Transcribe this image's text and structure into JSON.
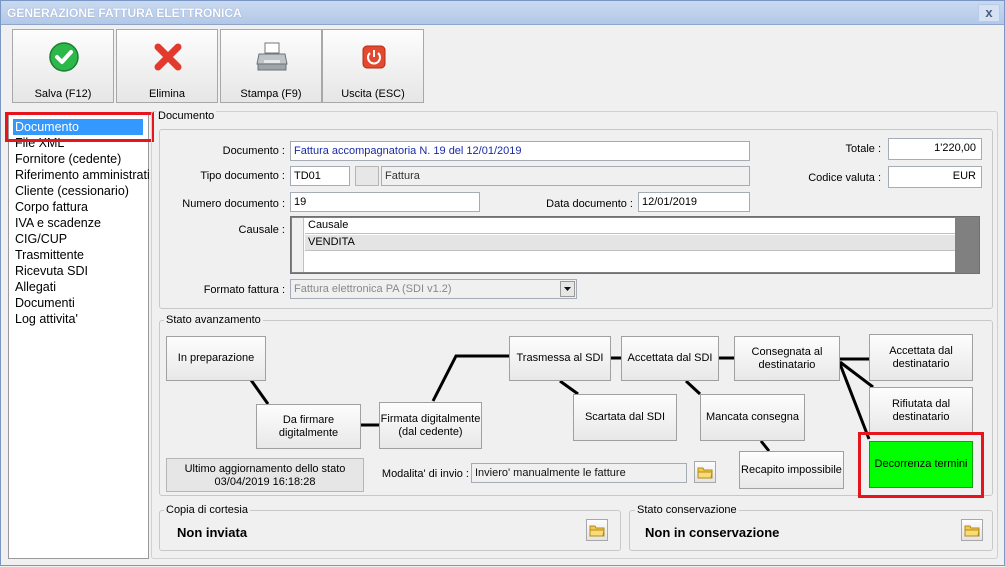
{
  "window": {
    "title": "GENERAZIONE FATTURA ELETTRONICA",
    "close_glyph": "x"
  },
  "toolbar": {
    "save_label": "Salva (F12)",
    "delete_label": "Elimina",
    "print_label": "Stampa (F9)",
    "exit_label": "Uscita (ESC)"
  },
  "sidebar": {
    "items": [
      "Documento",
      "File XML",
      "Fornitore (cedente)",
      "Riferimento amministrativo",
      "Cliente (cessionario)",
      "Corpo fattura",
      "IVA e scadenze",
      "CIG/CUP",
      "Trasmittente",
      "Ricevuta SDI",
      "Allegati",
      "Documenti",
      "Log attivita'"
    ],
    "selected": "Documento"
  },
  "documento": {
    "group_label": "Documento",
    "documento_label": "Documento :",
    "documento_value": "Fattura accompagnatoria N. 19 del 12/01/2019",
    "tipo_label": "Tipo documento :",
    "tipo_code": "TD01",
    "tipo_desc": "Fattura",
    "numero_label": "Numero documento :",
    "numero_value": "19",
    "data_label": "Data documento :",
    "data_value": "12/01/2019",
    "totale_label": "Totale :",
    "totale_value": "1'220,00",
    "valuta_label": "Codice valuta :",
    "valuta_value": "EUR",
    "causale_label": "Causale :",
    "causale_header": "Causale",
    "causale_rows": [
      "VENDITA"
    ],
    "formato_label": "Formato fattura :",
    "formato_value": "Fattura elettronica PA (SDI v1.2)"
  },
  "stato": {
    "group_label": "Stato avanzamento",
    "nodes": {
      "in_preparazione": "In preparazione",
      "da_firmare": "Da firmare\ndigitalmente",
      "firmata": "Firmata digitalmente\n(dal cedente)",
      "trasmessa": "Trasmessa al SDI",
      "scartata": "Scartata dal SDI",
      "accettata_sdi": "Accettata dal SDI",
      "mancata": "Mancata consegna",
      "consegnata": "Consegnata al\ndestinatario",
      "recapito": "Recapito impossibile",
      "accettata_dest": "Accettata dal\ndestinatario",
      "rifiutata": "Rifiutata dal\ndestinatario",
      "decorrenza": "Decorrenza termini"
    },
    "ultimo_aggiornamento_label": "Ultimo aggiornamento dello stato",
    "ultimo_aggiornamento_value": "03/04/2019 16:18:28",
    "modalita_label": "Modalita' di invio :",
    "modalita_value": "Inviero' manualmente le fatture"
  },
  "copia": {
    "group_label": "Copia di cortesia",
    "value": "Non inviata"
  },
  "conservazione": {
    "group_label": "Stato conservazione",
    "value": "Non in conservazione"
  },
  "colors": {
    "highlight": "#e8141b",
    "decorrenza": "#00ff00",
    "selection": "#3399ff",
    "title_text": "#ffffff"
  },
  "icons": [
    "check-icon",
    "x-icon",
    "printer-icon",
    "power-icon",
    "folder-icon",
    "dropdown-arrow-icon"
  ]
}
